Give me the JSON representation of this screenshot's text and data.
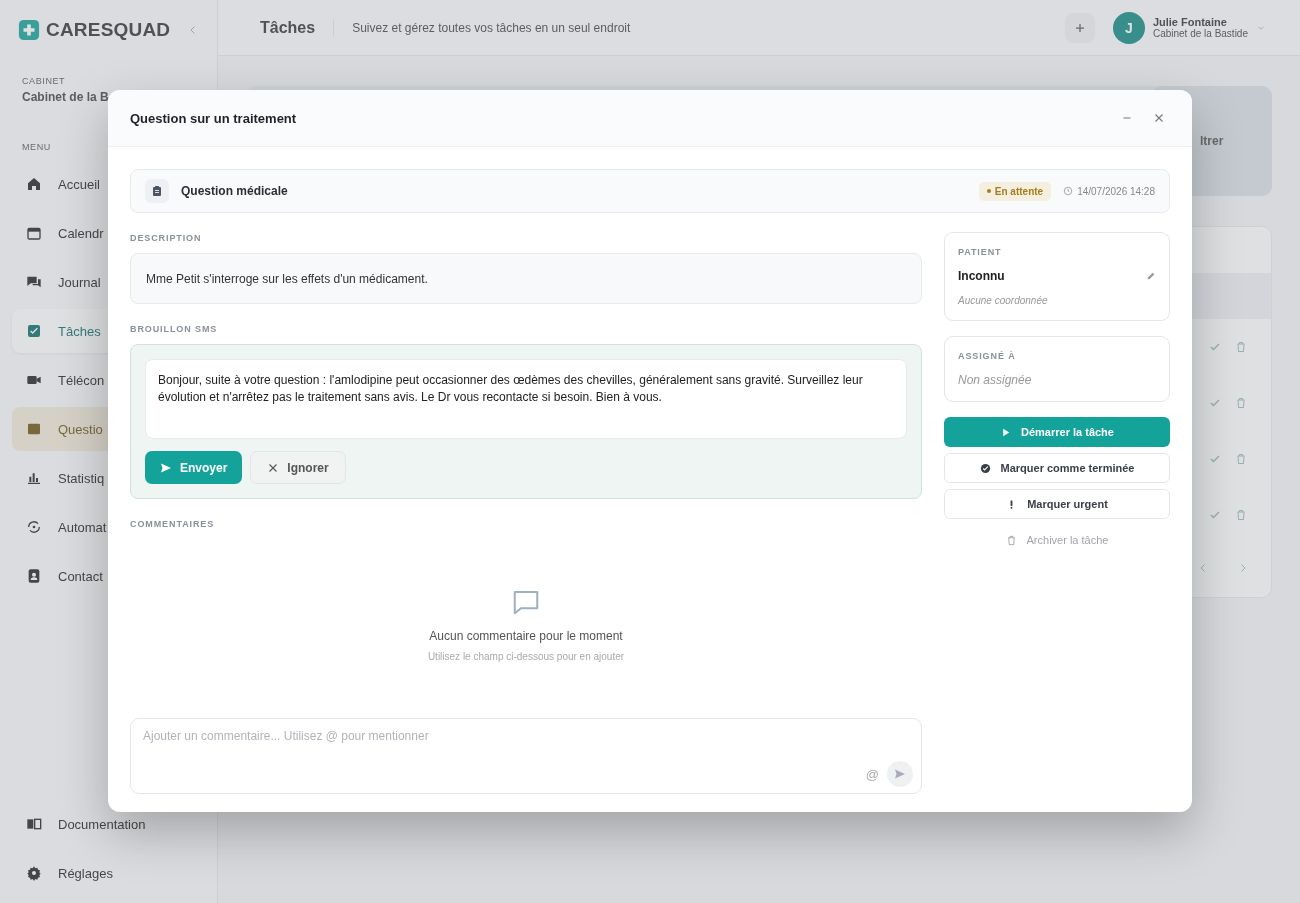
{
  "background": {
    "brand": "CARESQUAD",
    "page_title": "Tâches",
    "page_subtitle": "Suivez et gérez toutes vos tâches en un seul endroit",
    "user": {
      "initial": "J",
      "name": "Julie Fontaine",
      "org": "Cabinet de la Bastide"
    },
    "sidebar": {
      "cabinet_label": "CABINET",
      "cabinet_name": "Cabinet de la B",
      "menu_label": "MENU",
      "items": [
        {
          "label": "Accueil",
          "selected": false,
          "flagged": false
        },
        {
          "label": "Calendr",
          "selected": false,
          "flagged": false
        },
        {
          "label": "Journal",
          "selected": false,
          "flagged": false
        },
        {
          "label": "Tâches",
          "selected": true,
          "flagged": false
        },
        {
          "label": "Télécon",
          "selected": false,
          "flagged": false
        },
        {
          "label": "Questio",
          "selected": false,
          "flagged": true
        },
        {
          "label": "Statistiq",
          "selected": false,
          "flagged": false
        },
        {
          "label": "Automat",
          "selected": false,
          "flagged": false
        },
        {
          "label": "Contact",
          "selected": false,
          "flagged": false
        }
      ],
      "bottom_items": [
        {
          "label": "Documentation"
        },
        {
          "label": "Réglages"
        }
      ]
    },
    "filter_label": "ltrer"
  },
  "modal": {
    "title": "Question sur un traitement",
    "task": {
      "type": "Question médicale",
      "status": {
        "label": "En attente",
        "color": "#a67c1e"
      },
      "datetime": "14/07/2026 14:28"
    },
    "description": {
      "label": "DESCRIPTION",
      "text": "Mme Petit s'interroge sur les effets d'un médicament."
    },
    "sms_draft": {
      "label": "BROUILLON SMS",
      "text": "Bonjour, suite à votre question : l'amlodipine peut occasionner des œdèmes des chevilles, généralement sans gravité. Surveillez leur évolution et n'arrêtez pas le traitement sans avis. Le Dr vous recontacte si besoin. Bien à vous.",
      "buttons": [
        {
          "label": "Envoyer",
          "kind": "primary"
        },
        {
          "label": "Ignorer",
          "kind": "secondary"
        }
      ]
    },
    "comments": {
      "label": "COMMENTAIRES",
      "empty_title": "Aucun commentaire pour le moment",
      "empty_hint": "Utilisez le champ ci-dessous pour en ajouter",
      "input_placeholder": "Ajouter un commentaire... Utilisez @ pour mentionner",
      "mention_symbol": "@"
    },
    "patient": {
      "label": "PATIENT",
      "name": "Inconnu",
      "contact": "Aucune coordonnée"
    },
    "assignee": {
      "label": "ASSIGNÉ À",
      "value": "Non assignée"
    },
    "actions": [
      {
        "label": "Démarrer la tâche",
        "kind": "primary"
      },
      {
        "label": "Marquer comme terminée",
        "kind": "outline"
      },
      {
        "label": "Marquer urgent",
        "kind": "outline"
      },
      {
        "label": "Archiver la tâche",
        "kind": "link"
      }
    ]
  }
}
